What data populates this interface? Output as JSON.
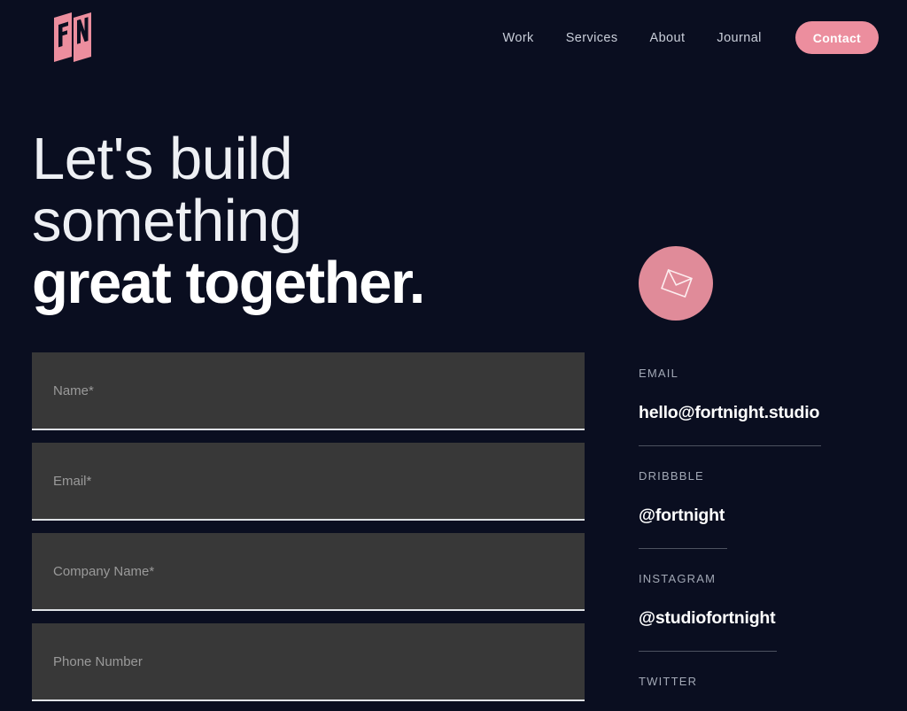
{
  "header": {
    "logo_alt": "FN",
    "nav": [
      {
        "label": "Work"
      },
      {
        "label": "Services"
      },
      {
        "label": "About"
      },
      {
        "label": "Journal"
      }
    ],
    "contact_button": "Contact"
  },
  "hero": {
    "line1": "Let's build",
    "line2": "something",
    "line3": "great together."
  },
  "form": {
    "fields": [
      {
        "placeholder": "Name*",
        "value": "",
        "name": "name"
      },
      {
        "placeholder": "Email*",
        "value": "",
        "name": "email"
      },
      {
        "placeholder": "Company Name*",
        "value": "",
        "name": "company"
      },
      {
        "placeholder": "Phone Number",
        "value": "",
        "name": "phone"
      }
    ]
  },
  "sidebar": {
    "badge_icon": "envelope-icon",
    "contacts": [
      {
        "label": "EMAIL",
        "value": "hello@fortnight.studio"
      },
      {
        "label": "DRIBBBLE",
        "value": "@fortnight"
      },
      {
        "label": "INSTAGRAM",
        "value": "@studiofortnight"
      },
      {
        "label": "TWITTER",
        "value": ""
      }
    ]
  },
  "colors": {
    "background": "#0a0e20",
    "accent_pink": "#ec8e9e",
    "badge_pink": "#e08b99",
    "field_fill": "#383838",
    "field_underline": "#dfe2e6",
    "label_gray": "#a2a8b5",
    "divider": "#4d5260"
  }
}
